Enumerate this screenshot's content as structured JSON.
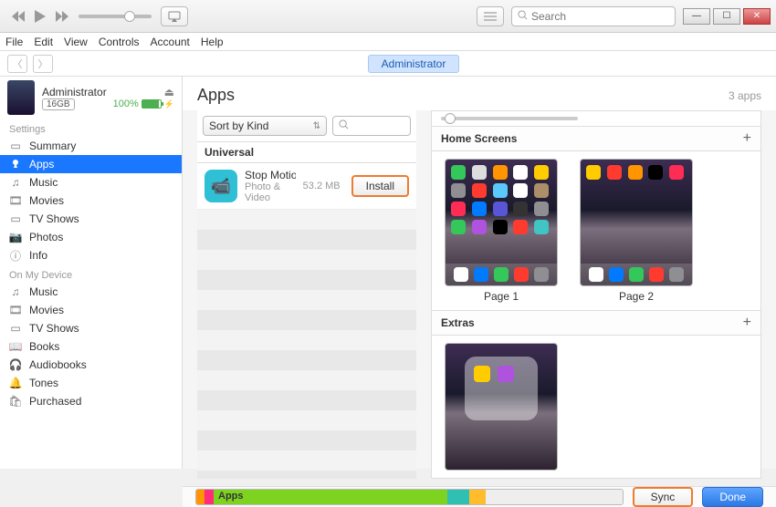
{
  "titlebar": {
    "search_placeholder": "Search"
  },
  "menu": {
    "file": "File",
    "edit": "Edit",
    "view": "View",
    "controls": "Controls",
    "account": "Account",
    "help": "Help"
  },
  "tabrow": {
    "admin_tab": "Administrator"
  },
  "device": {
    "name": "Administrator",
    "capacity": "16GB",
    "battery_pct": "100%"
  },
  "sidebar": {
    "settings_heading": "Settings",
    "settings": [
      {
        "label": "Summary"
      },
      {
        "label": "Apps"
      },
      {
        "label": "Music"
      },
      {
        "label": "Movies"
      },
      {
        "label": "TV Shows"
      },
      {
        "label": "Photos"
      },
      {
        "label": "Info"
      }
    ],
    "ondevice_heading": "On My Device",
    "ondevice": [
      {
        "label": "Music"
      },
      {
        "label": "Movies"
      },
      {
        "label": "TV Shows"
      },
      {
        "label": "Books"
      },
      {
        "label": "Audiobooks"
      },
      {
        "label": "Tones"
      },
      {
        "label": "Purchased"
      }
    ]
  },
  "apps": {
    "title": "Apps",
    "count": "3 apps",
    "sort_label": "Sort by Kind",
    "section": "Universal",
    "item": {
      "name": "Stop Motio...",
      "category": "Photo & Video",
      "size": "53.2 MB",
      "install": "Install"
    }
  },
  "home": {
    "home_heading": "Home Screens",
    "extras_heading": "Extras",
    "page1": "Page 1",
    "page2": "Page 2"
  },
  "bottom": {
    "storage_label": "Apps",
    "sync": "Sync",
    "done": "Done"
  }
}
